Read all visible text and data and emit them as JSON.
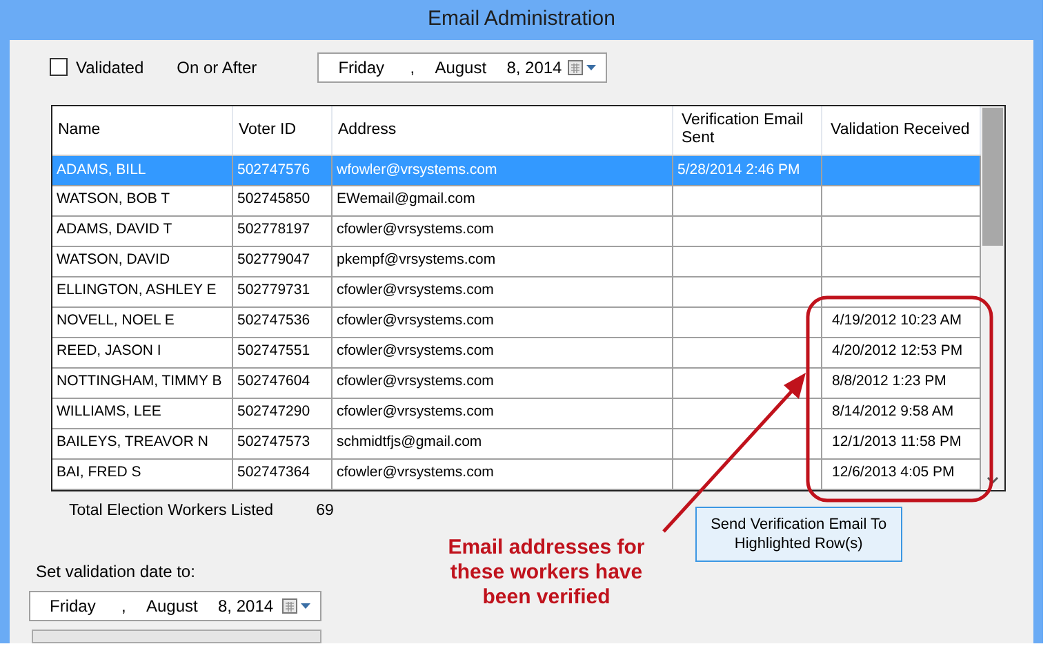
{
  "window": {
    "title": "Email Administration"
  },
  "filter": {
    "validated_checkbox": {
      "label": "Validated",
      "checked": false
    },
    "on_or_after_label": "On or After",
    "date": {
      "weekday": "Friday",
      "separator": ",",
      "month": "August",
      "day_year": "8, 2014"
    }
  },
  "table": {
    "columns": [
      {
        "label": "Name"
      },
      {
        "label": "Voter ID"
      },
      {
        "label": "Address"
      },
      {
        "label": "Verification Email Sent"
      },
      {
        "label": "Validation Received"
      }
    ],
    "rows": [
      {
        "name": "ADAMS, BILL",
        "voter_id": "502747576",
        "address": "wfowler@vrsystems.com",
        "verification_sent": "5/28/2014 2:46 PM",
        "validation_received": "",
        "selected": true
      },
      {
        "name": "WATSON, BOB T",
        "voter_id": "502745850",
        "address": "EWemail@gmail.com",
        "verification_sent": "",
        "validation_received": "",
        "selected": false
      },
      {
        "name": "ADAMS, DAVID T",
        "voter_id": "502778197",
        "address": "cfowler@vrsystems.com",
        "verification_sent": "",
        "validation_received": "",
        "selected": false
      },
      {
        "name": "WATSON, DAVID",
        "voter_id": "502779047",
        "address": "pkempf@vrsystems.com",
        "verification_sent": "",
        "validation_received": "",
        "selected": false
      },
      {
        "name": "ELLINGTON, ASHLEY E",
        "voter_id": "502779731",
        "address": "cfowler@vrsystems.com",
        "verification_sent": "",
        "validation_received": "",
        "selected": false
      },
      {
        "name": "NOVELL, NOEL E",
        "voter_id": "502747536",
        "address": "cfowler@vrsystems.com",
        "verification_sent": "",
        "validation_received": "4/19/2012 10:23 AM",
        "selected": false
      },
      {
        "name": "REED, JASON I",
        "voter_id": "502747551",
        "address": "cfowler@vrsystems.com",
        "verification_sent": "",
        "validation_received": "4/20/2012 12:53 PM",
        "selected": false
      },
      {
        "name": "NOTTINGHAM, TIMMY B",
        "voter_id": "502747604",
        "address": "cfowler@vrsystems.com",
        "verification_sent": "",
        "validation_received": "8/8/2012 1:23 PM",
        "selected": false
      },
      {
        "name": "WILLIAMS, LEE",
        "voter_id": "502747290",
        "address": "cfowler@vrsystems.com",
        "verification_sent": "",
        "validation_received": "8/14/2012 9:58 AM",
        "selected": false
      },
      {
        "name": "BAILEYS, TREAVOR N",
        "voter_id": "502747573",
        "address": "schmidtfjs@gmail.com",
        "verification_sent": "",
        "validation_received": "12/1/2013 11:58 PM",
        "selected": false
      },
      {
        "name": "BAI, FRED S",
        "voter_id": "502747364",
        "address": "cfowler@vrsystems.com",
        "verification_sent": "",
        "validation_received": "12/6/2013 4:05 PM",
        "selected": false
      }
    ]
  },
  "total": {
    "label": "Total Election Workers Listed",
    "value": "69"
  },
  "send_button": "Send Verification Email To Highlighted Row(s)",
  "set_validation": {
    "label": "Set validation date to:",
    "date": {
      "weekday": "Friday",
      "separator": ",",
      "month": "August",
      "day_year": "8, 2014"
    }
  },
  "annotation": {
    "text": "Email addresses for these workers have been verified"
  }
}
